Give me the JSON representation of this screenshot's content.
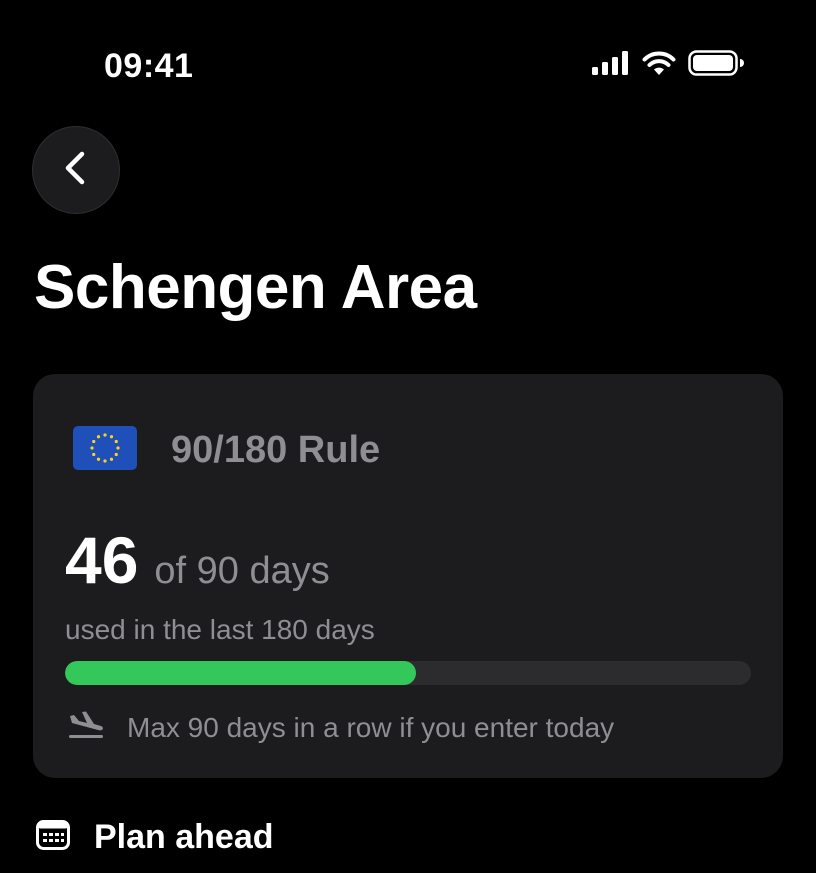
{
  "status_bar": {
    "time": "09:41",
    "icons": [
      "cellular-signal-icon",
      "wifi-icon",
      "battery-icon"
    ]
  },
  "header": {
    "back_icon": "chevron-left-icon",
    "title": "Schengen Area"
  },
  "rule_card": {
    "flag_icon": "eu-flag-icon",
    "title": "90/180 Rule",
    "days_used": "46",
    "days_total_text": "of 90 days",
    "window_text": "used in the last 180 days",
    "progress": {
      "used": 46,
      "total": 90
    },
    "footer_icon": "plane-arrival-icon",
    "footer_text": "Max 90 days in a row if you enter today"
  },
  "plan_ahead": {
    "icon": "calendar-icon",
    "label": "Plan ahead"
  },
  "colors": {
    "background": "#000000",
    "card": "#1c1c1e",
    "accent_green": "#34c759",
    "secondary_text": "#8e8e93",
    "track": "#2c2c2e"
  }
}
